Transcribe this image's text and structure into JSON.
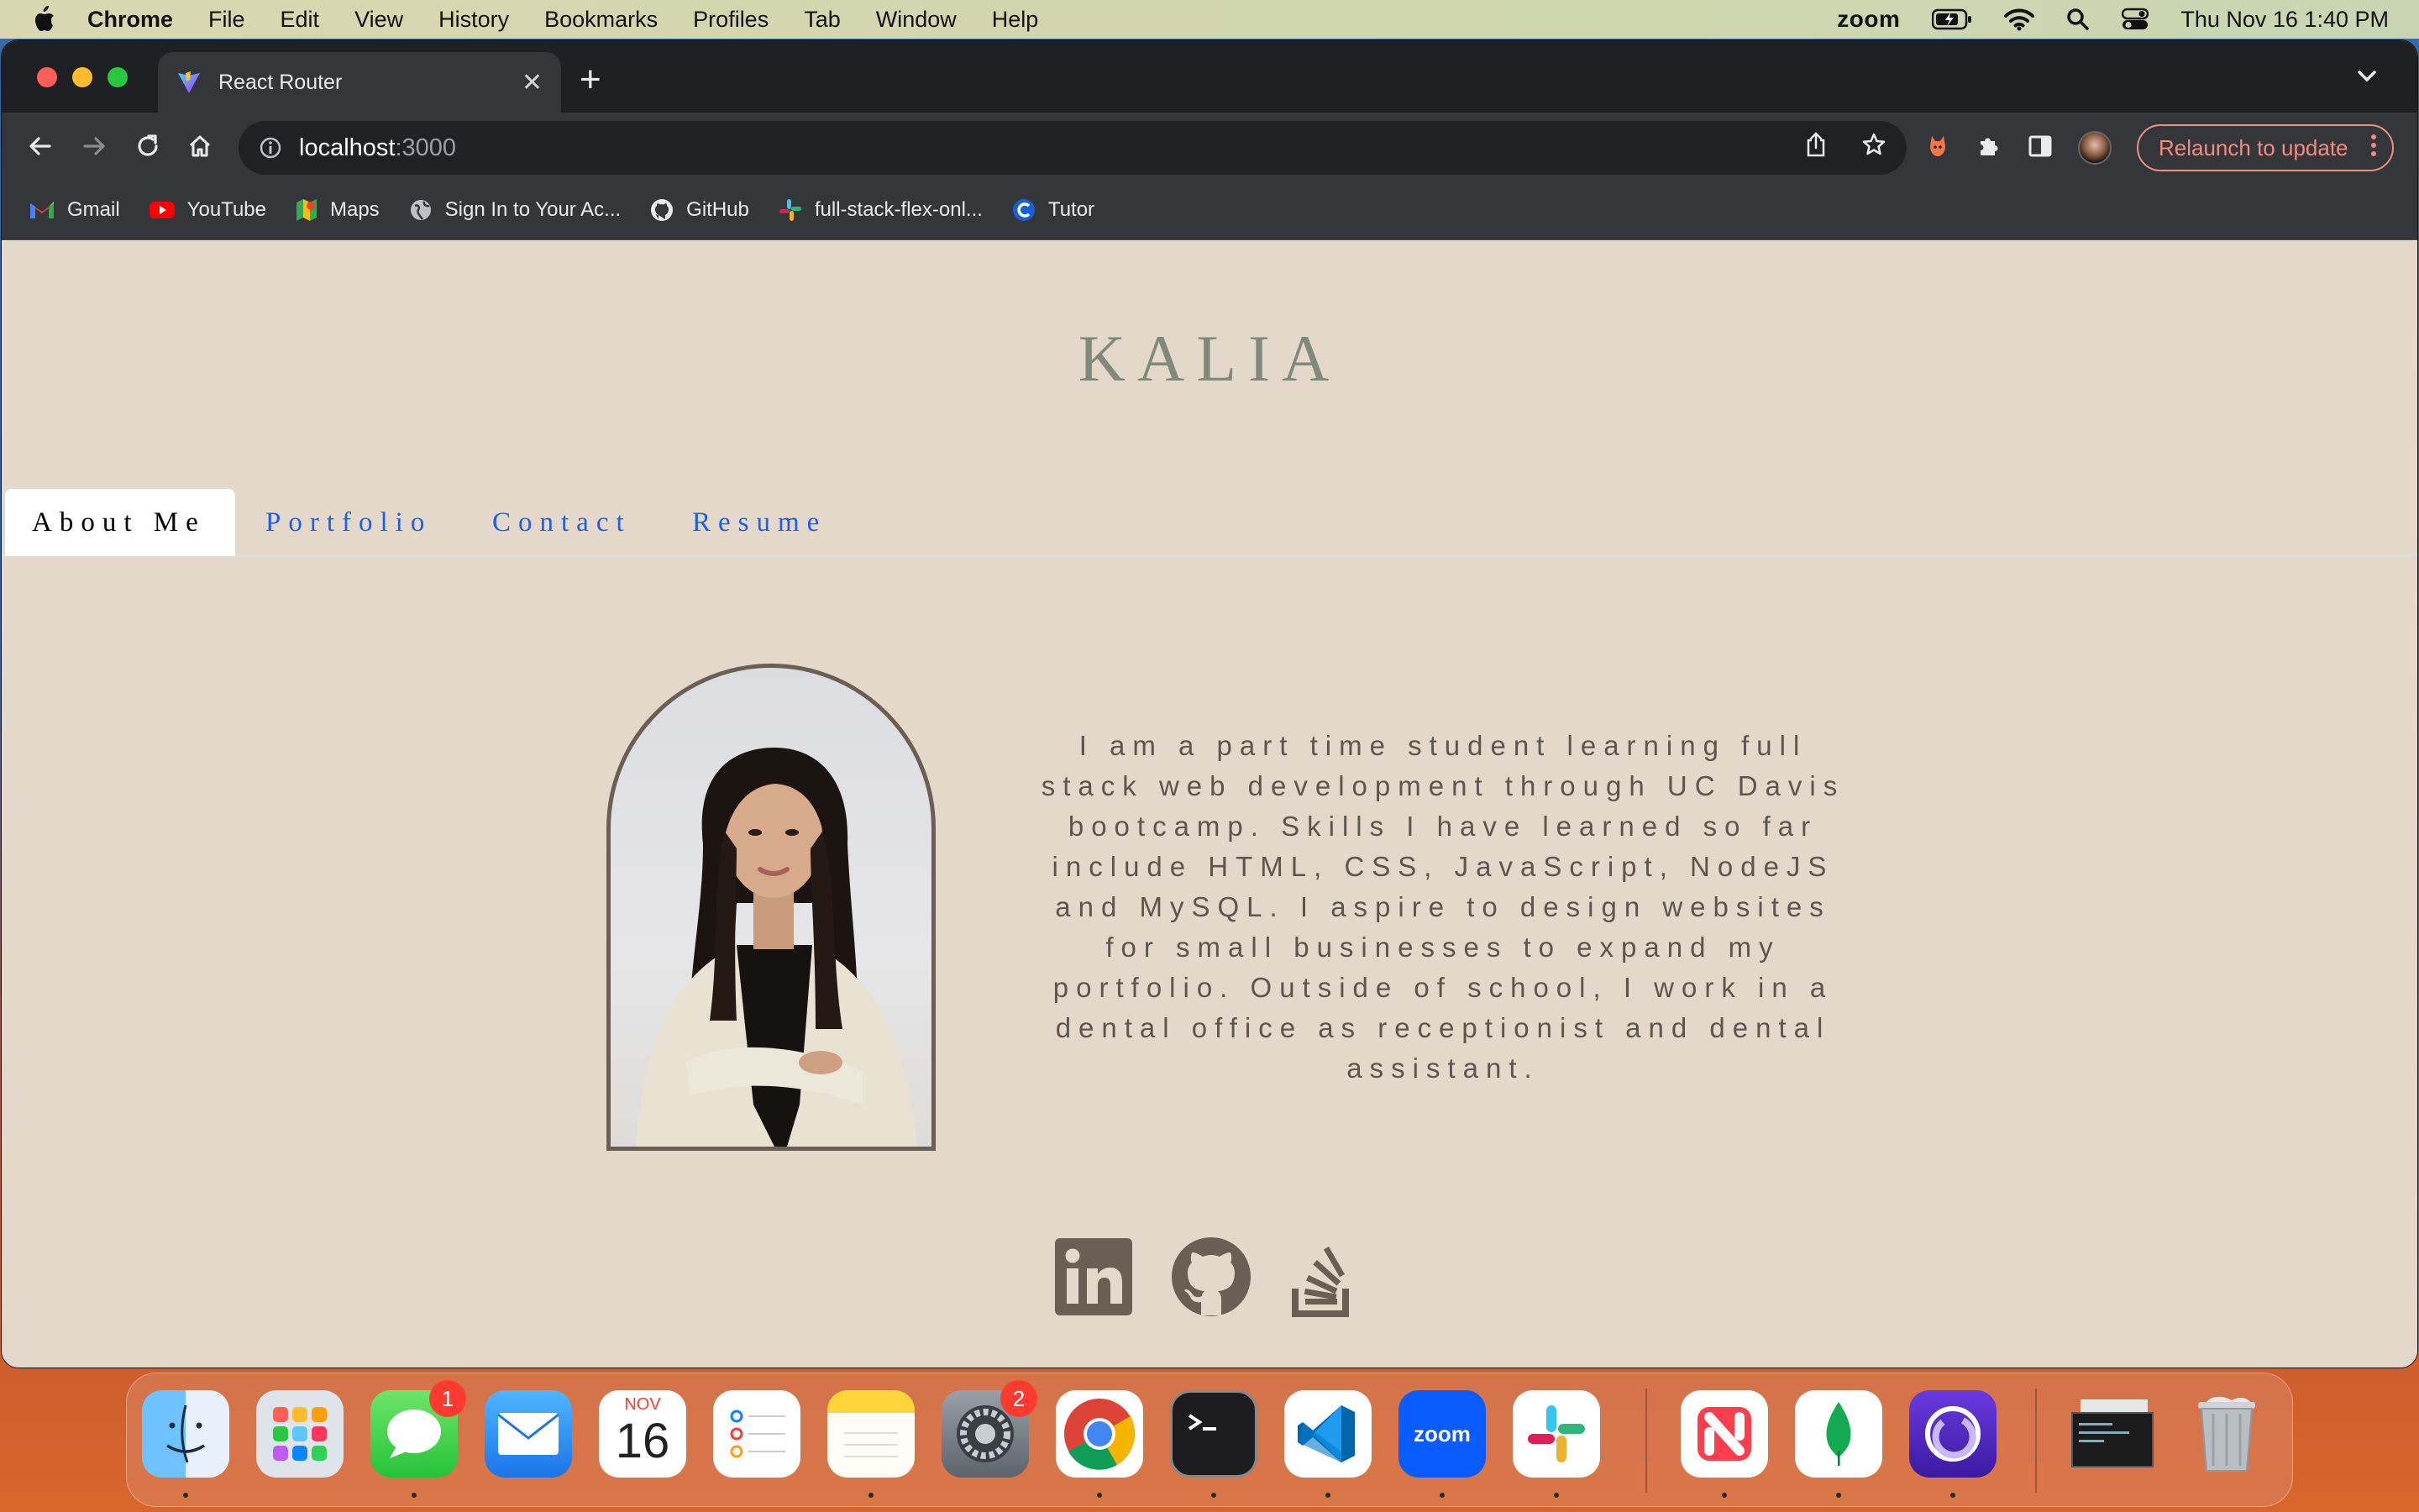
{
  "menubar": {
    "app_name": "Chrome",
    "items": [
      "File",
      "Edit",
      "View",
      "History",
      "Bookmarks",
      "Profiles",
      "Tab",
      "Window",
      "Help"
    ],
    "zoom_label": "zoom",
    "datetime": "Thu Nov 16  1:40 PM"
  },
  "browser": {
    "tab_title": "React Router",
    "url_host": "localhost",
    "url_port": ":3000",
    "relaunch_label": "Relaunch to update",
    "bookmarks": [
      "Gmail",
      "YouTube",
      "Maps",
      "Sign In to Your Ac...",
      "GitHub",
      "full-stack-flex-onl...",
      "Tutor"
    ]
  },
  "site": {
    "brand": "KALIA",
    "nav": [
      "About Me",
      "Portfolio",
      "Contact",
      "Resume"
    ],
    "active_tab": "About Me",
    "bio": "I am a part time student learning full stack web development through UC Davis bootcamp. Skills I have learned so far include HTML, CSS, JavaScript, NodeJS and MySQL. I aspire to design websites for small businesses to expand my portfolio. Outside of school, I work in a dental office as receptionist and dental assistant.",
    "social_icons": [
      "linkedin-icon",
      "github-icon",
      "stackoverflow-icon"
    ],
    "colors": {
      "background": "#e4d8ca",
      "brand": "#7f8a7c",
      "nav_link": "#1f5ee8",
      "text": "#5d564f",
      "icon": "#6b5e55"
    }
  },
  "dock": {
    "apps": [
      "Finder",
      "Launchpad",
      "Messages",
      "Mail",
      "Calendar",
      "Reminders",
      "Notes",
      "System Settings",
      "Chrome",
      "Terminal",
      "VS Code",
      "Zoom",
      "Slack",
      "News",
      "MongoDB Compass",
      "Browser",
      "Screenshot",
      "Trash"
    ],
    "messages_badge": "1",
    "settings_badge": "2",
    "calendar_month": "NOV",
    "calendar_day": "16",
    "zoom_label": "zoom"
  }
}
